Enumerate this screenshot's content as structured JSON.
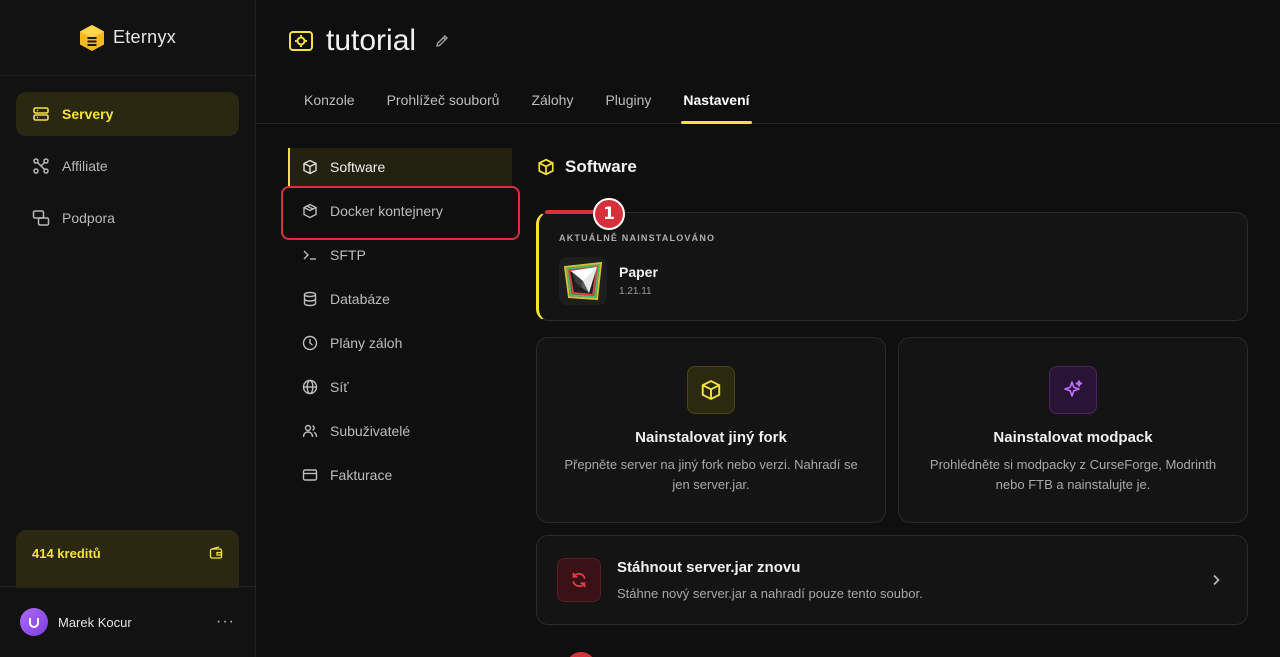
{
  "app": {
    "brand": "Eternyx"
  },
  "sidebar": {
    "items": [
      {
        "label": "Servery",
        "icon": "server-icon",
        "active": true
      },
      {
        "label": "Affiliate",
        "icon": "network-icon",
        "active": false
      },
      {
        "label": "Podpora",
        "icon": "chat-icon",
        "active": false
      }
    ],
    "credits": "414 kreditů",
    "user": {
      "name": "Marek Kocur",
      "more": "···"
    }
  },
  "header": {
    "title": "tutorial",
    "tabs": [
      {
        "label": "Konzole",
        "active": false
      },
      {
        "label": "Prohlížeč souborů",
        "active": false
      },
      {
        "label": "Zálohy",
        "active": false
      },
      {
        "label": "Pluginy",
        "active": false
      },
      {
        "label": "Nastavení",
        "active": true
      }
    ]
  },
  "settings_nav": {
    "items": [
      {
        "label": "Software",
        "icon": "box-icon",
        "active": true
      },
      {
        "label": "Docker kontejnery",
        "icon": "container-icon",
        "active": false
      },
      {
        "label": "SFTP",
        "icon": "terminal-icon",
        "active": false
      },
      {
        "label": "Databáze",
        "icon": "database-icon",
        "active": false
      },
      {
        "label": "Plány záloh",
        "icon": "clock-icon",
        "active": false
      },
      {
        "label": "Síť",
        "icon": "globe-icon",
        "active": false
      },
      {
        "label": "Subuživatelé",
        "icon": "users-icon",
        "active": false
      },
      {
        "label": "Fakturace",
        "icon": "card-icon",
        "active": false
      }
    ]
  },
  "main": {
    "section_title": "Software",
    "installed": {
      "label": "AKTUÁLNĚ NAINSTALOVÁNO",
      "name": "Paper",
      "version": "1.21.11"
    },
    "options": [
      {
        "title": "Nainstalovat jiný fork",
        "desc": "Přepněte server na jiný fork nebo verzi. Nahradí se jen server.jar."
      },
      {
        "title": "Nainstalovat modpack",
        "desc": "Prohlédněte si modpacky z CurseForge, Modrinth nebo FTB a nainstalujte je."
      }
    ],
    "redownload": {
      "title": "Stáhnout server.jar znovu",
      "desc": "Stáhne nový server.jar a nahradí pouze tento soubor."
    }
  },
  "annotation": {
    "number": "1"
  },
  "colors": {
    "accent": "#f5e23a",
    "annotation": "#d6303b",
    "modpack": "#c070ff",
    "danger": "#e04050"
  }
}
